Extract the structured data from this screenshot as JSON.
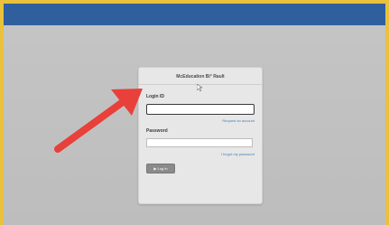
{
  "app": {
    "title": "McEducation Bi° Rault"
  },
  "login_form": {
    "login_label": "Login ID",
    "login_value": "",
    "request_link": "Request an account",
    "password_label": "Password",
    "password_value": "",
    "forgot_link": "I forgot my password",
    "login_button_label": "▶ Log In"
  },
  "colors": {
    "frame_border": "#e9c13c",
    "header_bar": "#305f9e",
    "background": "#c2c2c2",
    "card": "#e7e7e7",
    "link": "#4a7fb8",
    "button": "#8a8a8a",
    "annotation_arrow": "#e8403a"
  },
  "icons": {
    "annotation": "red-arrow-icon",
    "pointer": "mouse-cursor-icon"
  }
}
